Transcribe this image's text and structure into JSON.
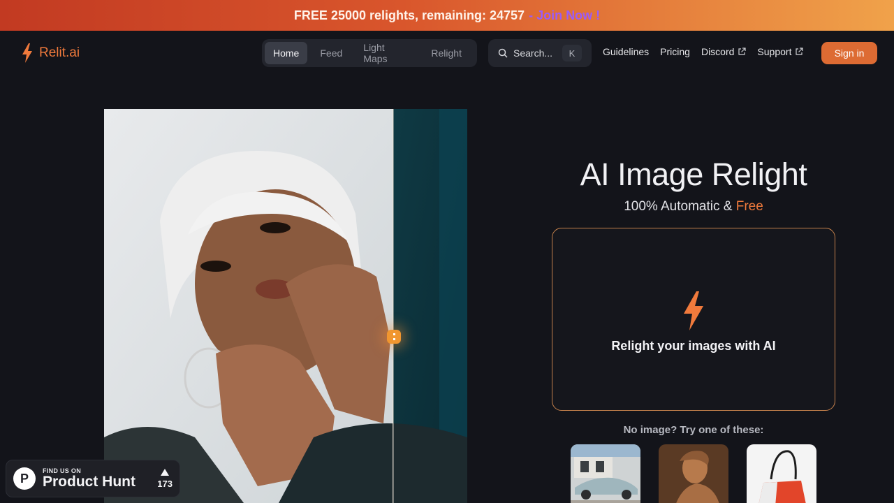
{
  "banner": {
    "text": "FREE 25000 relights, remaining: 24757",
    "link": "- Join Now !"
  },
  "header": {
    "logo_text": "Relit.ai",
    "tabs": [
      {
        "label": "Home",
        "active": true
      },
      {
        "label": "Feed",
        "active": false
      },
      {
        "label": "Light Maps",
        "active": false
      },
      {
        "label": "Relight",
        "active": false
      }
    ],
    "search": {
      "placeholder": "Search...",
      "shortcut": "K"
    },
    "links": [
      {
        "label": "Guidelines",
        "external": false
      },
      {
        "label": "Pricing",
        "external": false
      },
      {
        "label": "Discord",
        "external": true
      },
      {
        "label": "Support",
        "external": true
      }
    ],
    "signin_label": "Sign in"
  },
  "hero": {
    "title": "AI Image Relight",
    "subtitle_prefix": "100% Automatic &",
    "subtitle_free": "Free",
    "dropzone_text": "Relight your images with AI",
    "samples_label": "No image? Try one of these:",
    "samples": [
      "car-sample",
      "statue-sample",
      "handbag-sample"
    ]
  },
  "product_hunt": {
    "small": "FIND US ON",
    "big": "Product Hunt",
    "votes": "173",
    "badge_letter": "P"
  },
  "colors": {
    "accent": "#f07a3c",
    "background": "#13141a",
    "join_link": "#9b5cf6"
  }
}
